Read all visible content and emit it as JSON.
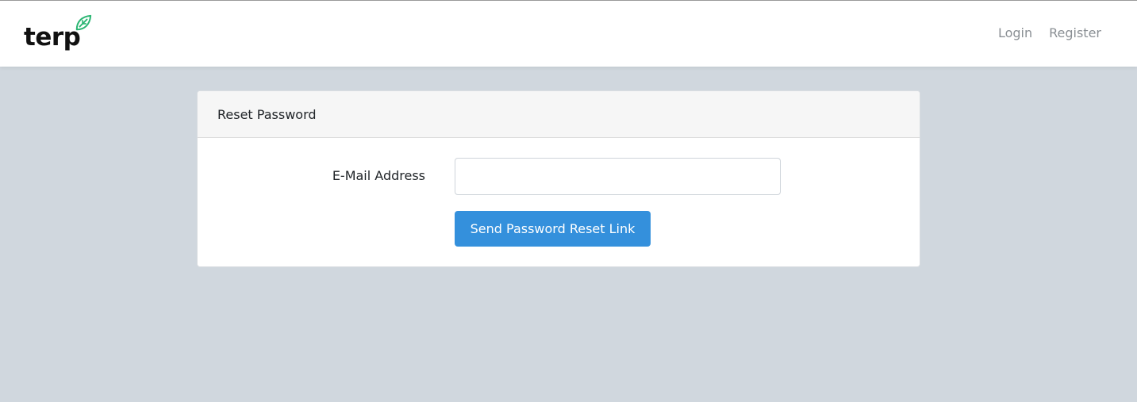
{
  "navbar": {
    "brand": "terp",
    "brand_logo_icon": "leaf-icon",
    "accent_color": "#2bb673",
    "links": [
      {
        "label": "Login"
      },
      {
        "label": "Register"
      }
    ]
  },
  "card": {
    "title": "Reset Password",
    "email_label": "E-Mail Address",
    "email_value": "",
    "email_placeholder": "",
    "submit_label": "Send Password Reset Link",
    "button_color": "#3490dc"
  }
}
